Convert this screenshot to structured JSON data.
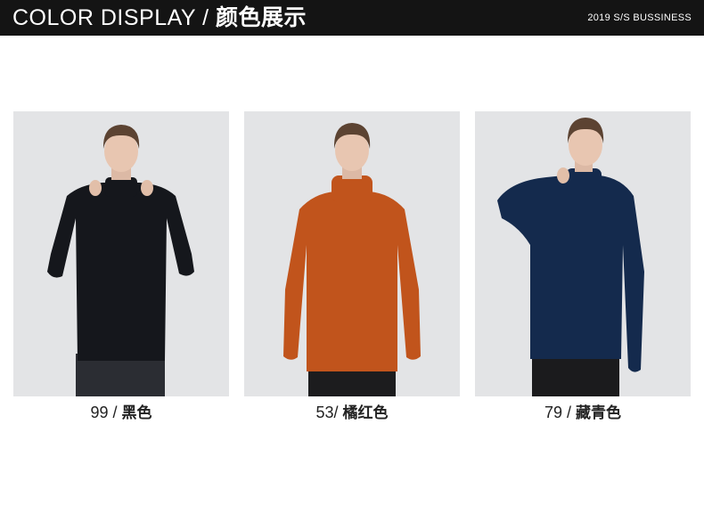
{
  "header": {
    "title_en": "COLOR DISPLAY /",
    "title_cn": "颜色展示",
    "meta": "2019 S/S BUSSINESS"
  },
  "products": [
    {
      "code": "99 /",
      "color_name": "黑色",
      "sweater_color": "#15171c",
      "pants_color": "#2b2d33"
    },
    {
      "code": "53/",
      "color_name": "橘红色",
      "sweater_color": "#c1541c",
      "pants_color": "#1c1c1e"
    },
    {
      "code": "79 /",
      "color_name": "藏青色",
      "sweater_color": "#142a4d",
      "pants_color": "#1b1b1d"
    }
  ]
}
